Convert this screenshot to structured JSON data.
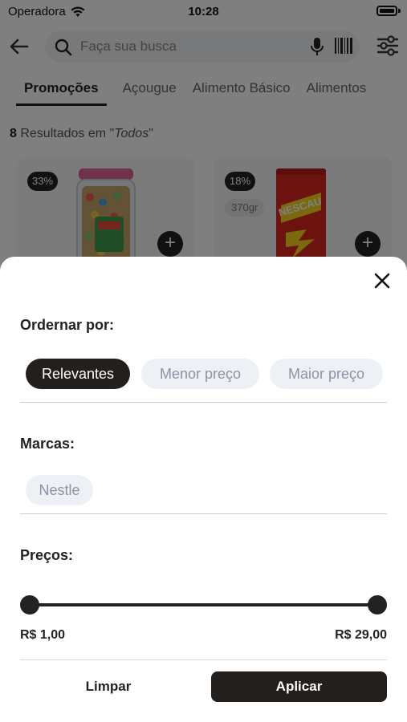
{
  "status_bar": {
    "carrier": "Operadora",
    "time": "10:28",
    "icons": [
      "wifi-icon",
      "battery-icon"
    ]
  },
  "header": {
    "search_placeholder": "Faça sua busca",
    "icons": [
      "back-arrow-icon",
      "search-icon",
      "mic-icon",
      "barcode-icon",
      "filter-sliders-icon"
    ]
  },
  "category_tabs": [
    {
      "label": "Promoções",
      "active": true
    },
    {
      "label": "Açougue",
      "active": false
    },
    {
      "label": "Alimento Básico",
      "active": false
    },
    {
      "label": "Alimentos",
      "active": false
    }
  ],
  "results": {
    "count": "8",
    "text": " Resultados em \"",
    "scope": "Todos",
    "suffix": "\""
  },
  "products": [
    {
      "discount": "33%",
      "weight": "",
      "image": "candy-jar"
    },
    {
      "discount": "18%",
      "weight": "370gr",
      "image": "nescau-can",
      "brand_text": "NESCAU"
    }
  ],
  "filter_sheet": {
    "order_title": "Ordernar por:",
    "order_options": [
      {
        "label": "Relevantes",
        "selected": true
      },
      {
        "label": "Menor preço",
        "selected": false
      },
      {
        "label": "Maior preço",
        "selected": false
      }
    ],
    "brands_title": "Marcas:",
    "brands": [
      {
        "label": "Nestle",
        "selected": false
      }
    ],
    "prices_title": "Preços:",
    "price_min": "R$ 1,00",
    "price_max": "R$ 29,00",
    "clear_label": "Limpar",
    "apply_label": "Aplicar"
  },
  "colors": {
    "primary_dark": "#231f1d",
    "chip_unselected_bg": "#edf1f6",
    "chip_unselected_text": "#8a94a3"
  }
}
